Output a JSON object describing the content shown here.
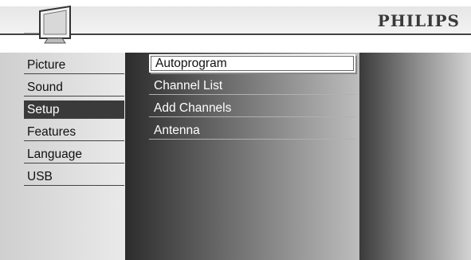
{
  "header": {
    "brand": "PHILIPS",
    "icon": "tv-icon"
  },
  "menu": {
    "items": [
      {
        "label": "Picture",
        "selected": false
      },
      {
        "label": "Sound",
        "selected": false
      },
      {
        "label": "Setup",
        "selected": true
      },
      {
        "label": "Features",
        "selected": false
      },
      {
        "label": "Language",
        "selected": false
      },
      {
        "label": "USB",
        "selected": false
      }
    ]
  },
  "submenu": {
    "items": [
      {
        "label": "Autoprogram",
        "selected": true
      },
      {
        "label": "Channel List",
        "selected": false
      },
      {
        "label": "Add Channels",
        "selected": false
      },
      {
        "label": "Antenna",
        "selected": false
      }
    ]
  },
  "colors": {
    "selected_menu_bg": "#3a3a3a",
    "selected_submenu_bg": "#ffffff"
  }
}
